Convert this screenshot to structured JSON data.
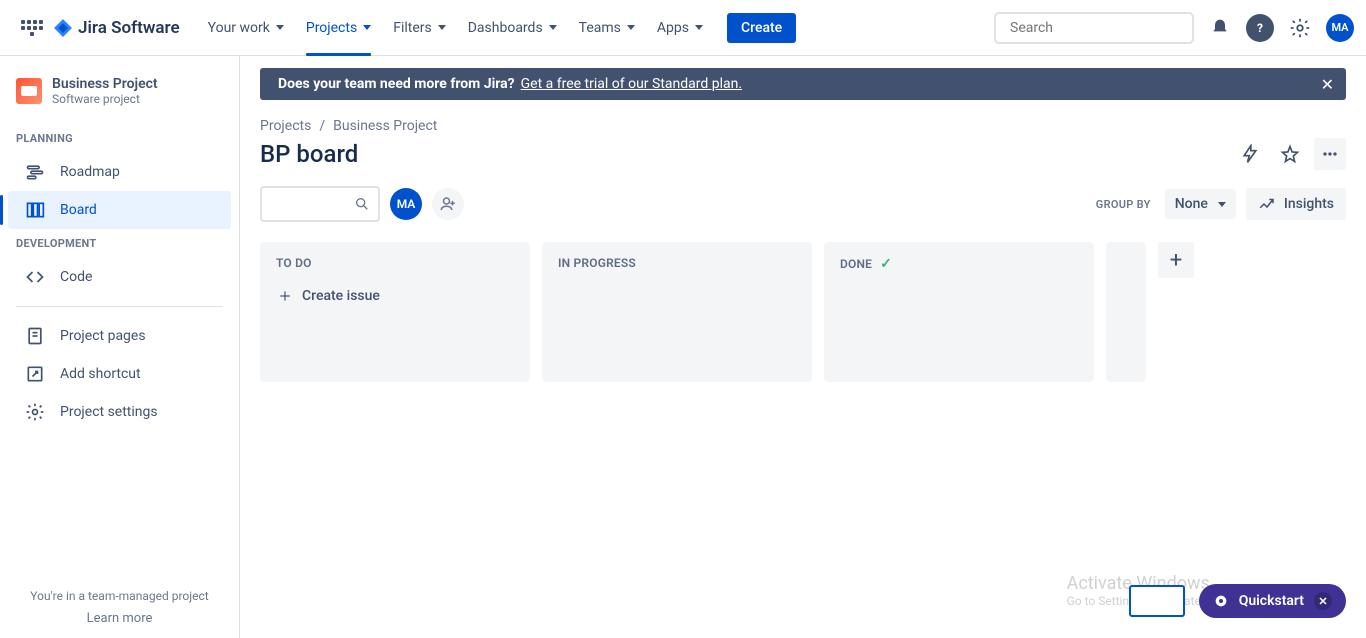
{
  "topnav": {
    "logo": "Jira Software",
    "items": [
      "Your work",
      "Projects",
      "Filters",
      "Dashboards",
      "Teams",
      "Apps"
    ],
    "active_index": 1,
    "create": "Create",
    "search_placeholder": "Search",
    "avatar_initials": "MA"
  },
  "sidebar": {
    "project_name": "Business Project",
    "project_type": "Software project",
    "groups": [
      {
        "label": "PLANNING",
        "items": [
          {
            "name": "Roadmap",
            "icon": "roadmap-icon",
            "active": false
          },
          {
            "name": "Board",
            "icon": "board-icon",
            "active": true
          }
        ]
      },
      {
        "label": "DEVELOPMENT",
        "items": [
          {
            "name": "Code",
            "icon": "code-icon",
            "active": false
          }
        ]
      }
    ],
    "extra": [
      {
        "name": "Project pages",
        "icon": "page-icon"
      },
      {
        "name": "Add shortcut",
        "icon": "shortcut-icon"
      },
      {
        "name": "Project settings",
        "icon": "gear-icon"
      }
    ],
    "footer_text": "You're in a team-managed project",
    "footer_link": "Learn more"
  },
  "banner": {
    "lead": "Does your team need more from Jira?",
    "link": "Get a free trial of our Standard plan."
  },
  "breadcrumbs": [
    "Projects",
    "Business Project"
  ],
  "page": {
    "title": "BP board",
    "group_by_label": "GROUP BY",
    "group_by_value": "None",
    "insights": "Insights",
    "avatar_initials": "MA"
  },
  "board": {
    "columns": [
      {
        "name": "TO DO",
        "done": false
      },
      {
        "name": "IN PROGRESS",
        "done": false
      },
      {
        "name": "DONE",
        "done": true
      }
    ],
    "create_issue": "Create issue"
  },
  "quickstart": "Quickstart",
  "watermark": {
    "line1": "Activate Windows",
    "line2": "Go to Settings to activate Windows."
  }
}
